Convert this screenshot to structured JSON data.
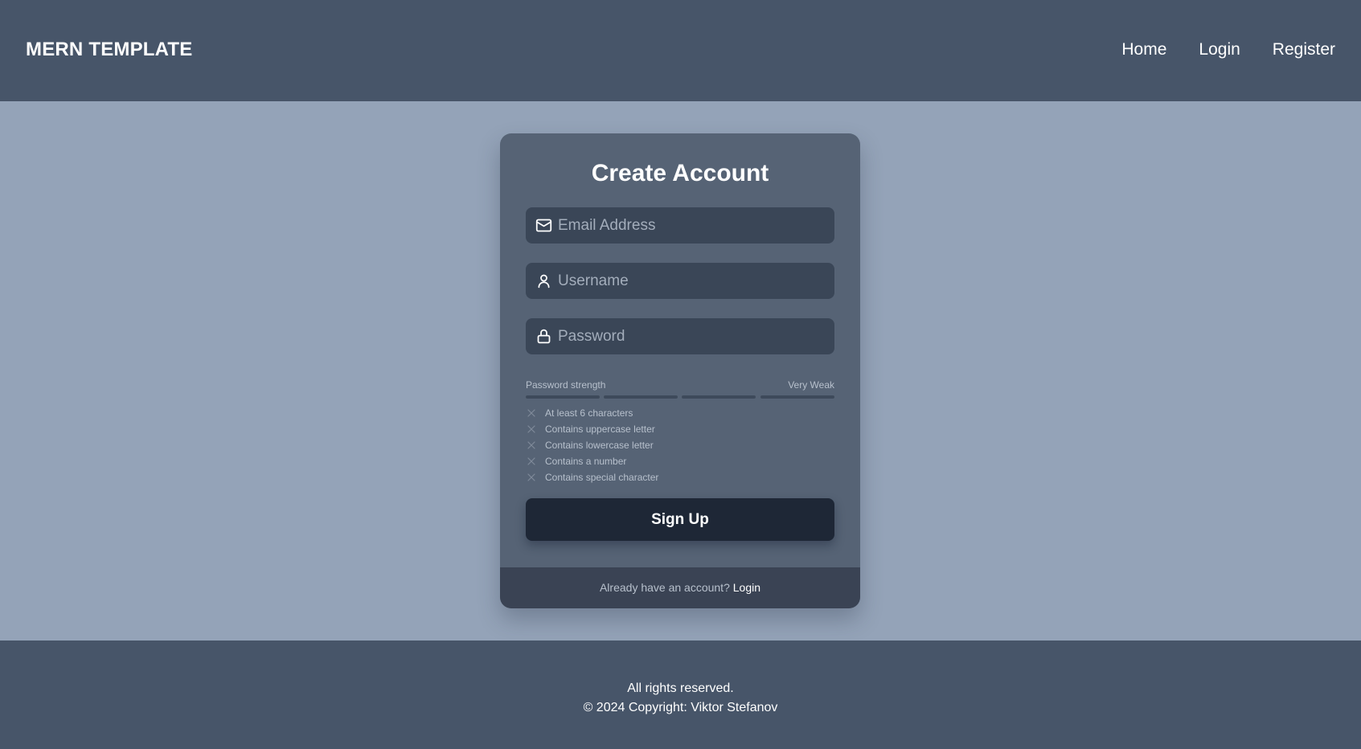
{
  "navbar": {
    "brand": "MERN TEMPLATE",
    "links": [
      "Home",
      "Login",
      "Register"
    ]
  },
  "form": {
    "title": "Create Account",
    "fields": [
      {
        "placeholder": "Email Address",
        "value": "",
        "icon": "mail-icon"
      },
      {
        "placeholder": "Username",
        "value": "",
        "icon": "user-icon"
      },
      {
        "placeholder": "Password",
        "value": "",
        "icon": "lock-icon"
      }
    ],
    "strength": {
      "label": "Password strength",
      "level_text": "Very Weak",
      "filled_segments": 0,
      "total_segments": 4
    },
    "requirements": [
      {
        "text": "At least 6 characters",
        "met": false
      },
      {
        "text": "Contains uppercase letter",
        "met": false
      },
      {
        "text": "Contains lowercase letter",
        "met": false
      },
      {
        "text": "Contains a number",
        "met": false
      },
      {
        "text": "Contains special character",
        "met": false
      }
    ],
    "submit_label": "Sign Up",
    "footer_text": "Already have an account?",
    "footer_link": "Login"
  },
  "footer": {
    "line1": "All rights reserved.",
    "line2": "© 2024 Copyright: Viktor Stefanov"
  },
  "colors": {
    "header_bg": "#475569",
    "page_bg": "#94a3b8",
    "card_bg": "#566375",
    "input_bg": "#3a4657",
    "button_bg": "#1e2736"
  }
}
